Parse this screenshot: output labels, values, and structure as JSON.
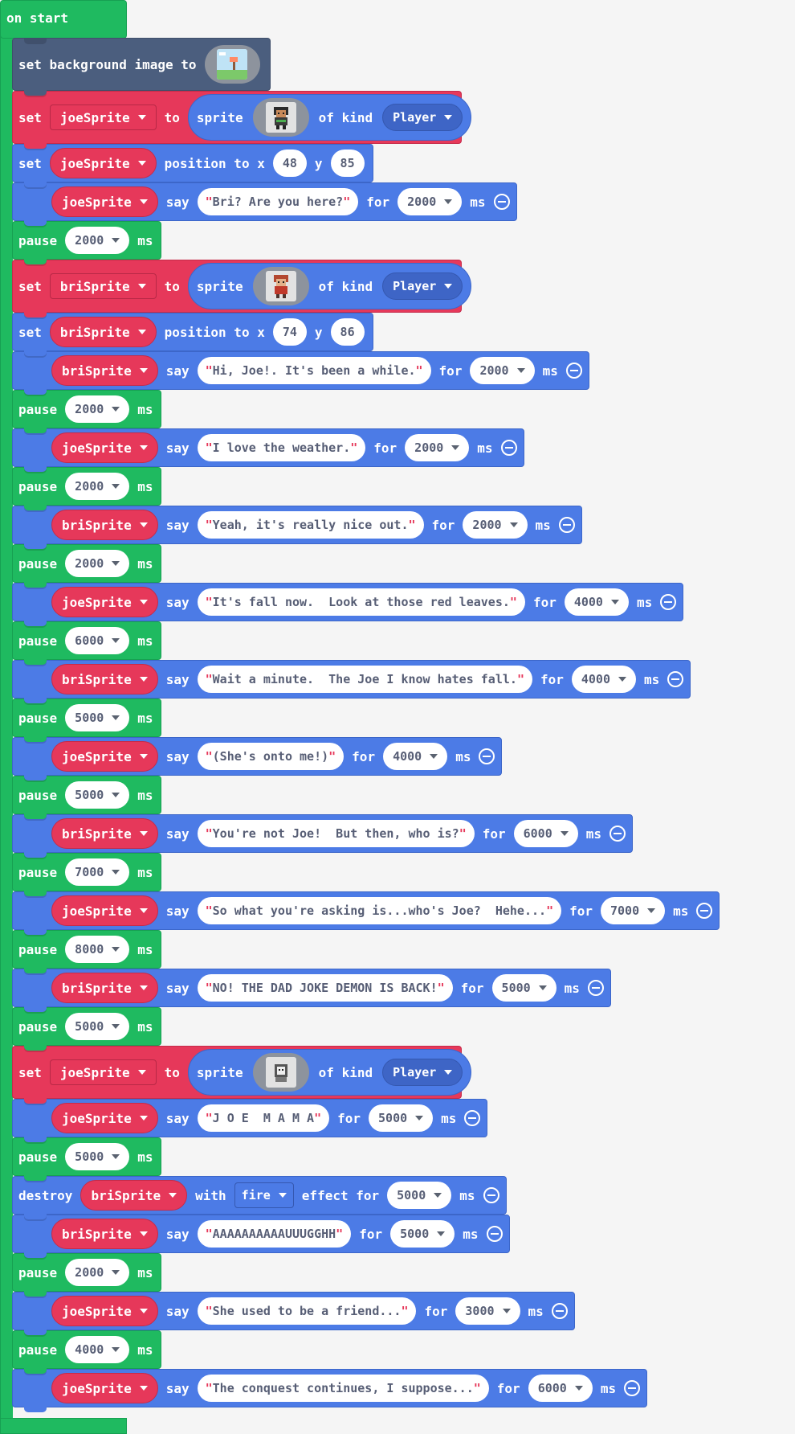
{
  "hat": {
    "label": "on start"
  },
  "blocks": [
    {
      "kind": "bg",
      "set": "set background image to",
      "image_icon": "landscape-image-icon"
    },
    {
      "kind": "setsprite",
      "set": "set",
      "var": "joeSprite",
      "to": "to",
      "sprite": "sprite",
      "of_kind": "of kind",
      "kind_value": "Player",
      "image_icon": "joe-sprite-image"
    },
    {
      "kind": "pos",
      "set": "set",
      "var": "joeSprite",
      "pos": "position to x",
      "x": "48",
      "y_label": "y",
      "y": "85"
    },
    {
      "kind": "say",
      "var": "joeSprite",
      "say": "say",
      "text": "Bri? Are you here?",
      "for": "for",
      "ms_val": "2000",
      "ms": "ms"
    },
    {
      "kind": "pause",
      "pause": "pause",
      "val": "2000",
      "ms": "ms"
    },
    {
      "kind": "setsprite",
      "set": "set",
      "var": "briSprite",
      "to": "to",
      "sprite": "sprite",
      "of_kind": "of kind",
      "kind_value": "Player",
      "image_icon": "bri-sprite-image"
    },
    {
      "kind": "pos",
      "set": "set",
      "var": "briSprite",
      "pos": "position to x",
      "x": "74",
      "y_label": "y",
      "y": "86"
    },
    {
      "kind": "say",
      "var": "briSprite",
      "say": "say",
      "text": "Hi, Joe!. It's been a while.",
      "for": "for",
      "ms_val": "2000",
      "ms": "ms"
    },
    {
      "kind": "pause",
      "pause": "pause",
      "val": "2000",
      "ms": "ms"
    },
    {
      "kind": "say",
      "var": "joeSprite",
      "say": "say",
      "text": "I love the weather.",
      "for": "for",
      "ms_val": "2000",
      "ms": "ms"
    },
    {
      "kind": "pause",
      "pause": "pause",
      "val": "2000",
      "ms": "ms"
    },
    {
      "kind": "say",
      "var": "briSprite",
      "say": "say",
      "text": "Yeah, it's really nice out.",
      "for": "for",
      "ms_val": "2000",
      "ms": "ms"
    },
    {
      "kind": "pause",
      "pause": "pause",
      "val": "2000",
      "ms": "ms"
    },
    {
      "kind": "say",
      "var": "joeSprite",
      "say": "say",
      "text": "It's fall now.  Look at those red leaves.",
      "for": "for",
      "ms_val": "4000",
      "ms": "ms"
    },
    {
      "kind": "pause",
      "pause": "pause",
      "val": "6000",
      "ms": "ms"
    },
    {
      "kind": "say",
      "var": "briSprite",
      "say": "say",
      "text": "Wait a minute.  The Joe I know hates fall.",
      "for": "for",
      "ms_val": "4000",
      "ms": "ms"
    },
    {
      "kind": "pause",
      "pause": "pause",
      "val": "5000",
      "ms": "ms"
    },
    {
      "kind": "say",
      "var": "joeSprite",
      "say": "say",
      "text": "(She's onto me!)",
      "for": "for",
      "ms_val": "4000",
      "ms": "ms"
    },
    {
      "kind": "pause",
      "pause": "pause",
      "val": "5000",
      "ms": "ms"
    },
    {
      "kind": "say",
      "var": "briSprite",
      "say": "say",
      "text": "You're not Joe!  But then, who is?",
      "for": "for",
      "ms_val": "6000",
      "ms": "ms"
    },
    {
      "kind": "pause",
      "pause": "pause",
      "val": "7000",
      "ms": "ms"
    },
    {
      "kind": "say",
      "var": "joeSprite",
      "say": "say",
      "text": "So what you're asking is...who's Joe?  Hehe...",
      "for": "for",
      "ms_val": "7000",
      "ms": "ms"
    },
    {
      "kind": "pause",
      "pause": "pause",
      "val": "8000",
      "ms": "ms"
    },
    {
      "kind": "say",
      "var": "briSprite",
      "say": "say",
      "text": "NO! THE DAD JOKE DEMON IS BACK!",
      "for": "for",
      "ms_val": "5000",
      "ms": "ms"
    },
    {
      "kind": "pause",
      "pause": "pause",
      "val": "5000",
      "ms": "ms"
    },
    {
      "kind": "setsprite",
      "set": "set",
      "var": "joeSprite",
      "to": "to",
      "sprite": "sprite",
      "of_kind": "of kind",
      "kind_value": "Player",
      "image_icon": "demon-sprite-image"
    },
    {
      "kind": "say",
      "var": "joeSprite",
      "say": "say",
      "text": "J O E  M A M A",
      "for": "for",
      "ms_val": "5000",
      "ms": "ms"
    },
    {
      "kind": "pause",
      "pause": "pause",
      "val": "5000",
      "ms": "ms"
    },
    {
      "kind": "destroy",
      "destroy": "destroy",
      "var": "briSprite",
      "with": "with",
      "effect": "fire",
      "effect_label": "effect for",
      "ms_val": "5000",
      "ms": "ms"
    },
    {
      "kind": "say",
      "var": "briSprite",
      "say": "say",
      "text": "AAAAAAAAAAUUUGGHH",
      "for": "for",
      "ms_val": "5000",
      "ms": "ms"
    },
    {
      "kind": "pause",
      "pause": "pause",
      "val": "2000",
      "ms": "ms"
    },
    {
      "kind": "say",
      "var": "joeSprite",
      "say": "say",
      "text": "She used to be a friend...",
      "for": "for",
      "ms_val": "3000",
      "ms": "ms"
    },
    {
      "kind": "pause",
      "pause": "pause",
      "val": "4000",
      "ms": "ms"
    },
    {
      "kind": "say",
      "var": "joeSprite",
      "say": "say",
      "text": "The conquest continues, I suppose...",
      "for": "for",
      "ms_val": "6000",
      "ms": "ms"
    }
  ],
  "colors": {
    "events": "#1fba60",
    "scene": "#4b5e7e",
    "sprites": "#e6385a",
    "say": "#4c7be6"
  }
}
